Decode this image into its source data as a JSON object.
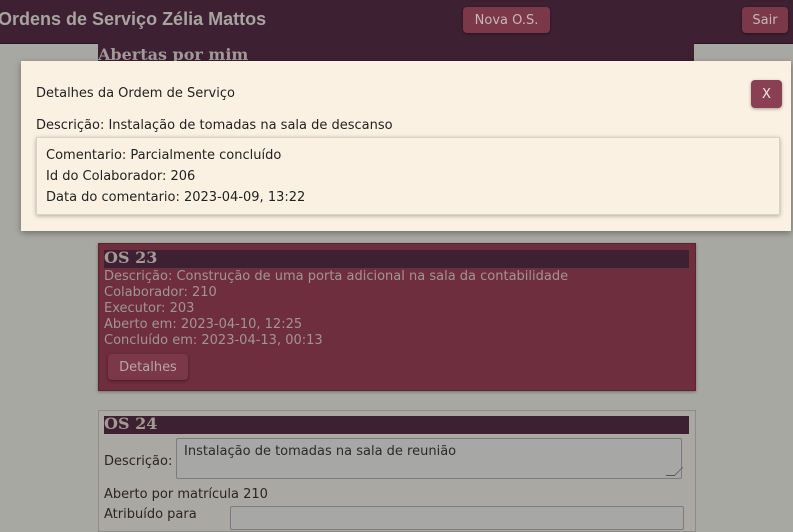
{
  "header": {
    "title": "Ordens de Serviço Zélia Mattos",
    "new_button": "Nova O.S.",
    "exit_button": "Sair"
  },
  "section": {
    "title": "Abertas por mim"
  },
  "order_23": {
    "title": "OS 23",
    "description": "Descrição: Construção de uma porta adicional na sala da contabilidade",
    "collaborator": "Colaborador: 210",
    "executor": "Executor: 203",
    "opened": "Aberto em: 2023-04-10, 12:25",
    "completed": "Concluído em: 2023-04-13, 00:13",
    "details_button": "Detalhes"
  },
  "order_24": {
    "title": "OS 24",
    "description_label": "Descrição:",
    "description_value": "Instalação de tomadas na sala de reunião",
    "opened_by": "Aberto por matrícula 210",
    "assigned_label": "Atribuído para"
  },
  "modal": {
    "title": "Detalhes da Ordem de Serviço",
    "close_button": "X",
    "description": "Descrição: Instalação de tomadas na sala de descanso",
    "comment": "Comentario: Parcialmente concluído",
    "collaborator_id": "Id do Colaborador: 206",
    "comment_date": "Data do comentario: 2023-04-09, 13:22"
  }
}
